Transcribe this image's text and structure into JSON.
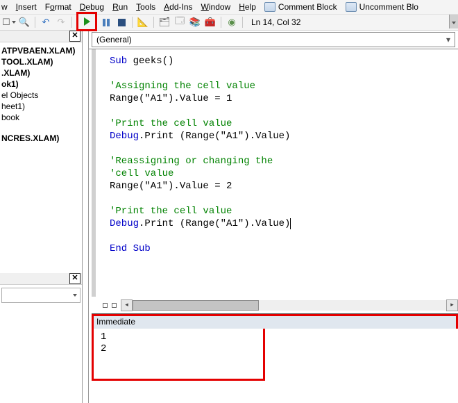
{
  "menu": {
    "view": "w",
    "insert": "Insert",
    "format": "Format",
    "debug": "Debug",
    "run": "Run",
    "tools": "Tools",
    "addins": "Add-Ins",
    "window": "Window",
    "help": "Help",
    "comment": "Comment Block",
    "uncomment": "Uncomment Blo"
  },
  "toolbar": {
    "status": "Ln 14, Col 32"
  },
  "explorer": {
    "items": [
      "ATPVBAEN.XLAM)",
      "TOOL.XLAM)",
      ".XLAM)",
      "ok1)",
      "el Objects",
      "heet1)",
      "book",
      "NCRES.XLAM)"
    ]
  },
  "objectbox": {
    "general": "(General)"
  },
  "code": {
    "l1a": "Sub",
    "l1b": " geeks()",
    "l2": "'Assigning the cell value",
    "l3": "Range(\"A1\").Value = 1",
    "l4": "'Print the cell value",
    "l5a": "Debug",
    "l5b": ".Print (Range(\"A1\").Value)",
    "l6": "'Reassigning or changing the",
    "l7": "'cell value",
    "l8": "Range(\"A1\").Value = 2",
    "l9": "'Print the cell value",
    "l10a": "Debug",
    "l10b": ".Print (Range(\"A1\").Value)",
    "l11": "End Sub"
  },
  "immediate": {
    "title": "Immediate",
    "l1": " 1",
    "l2": " 2"
  }
}
